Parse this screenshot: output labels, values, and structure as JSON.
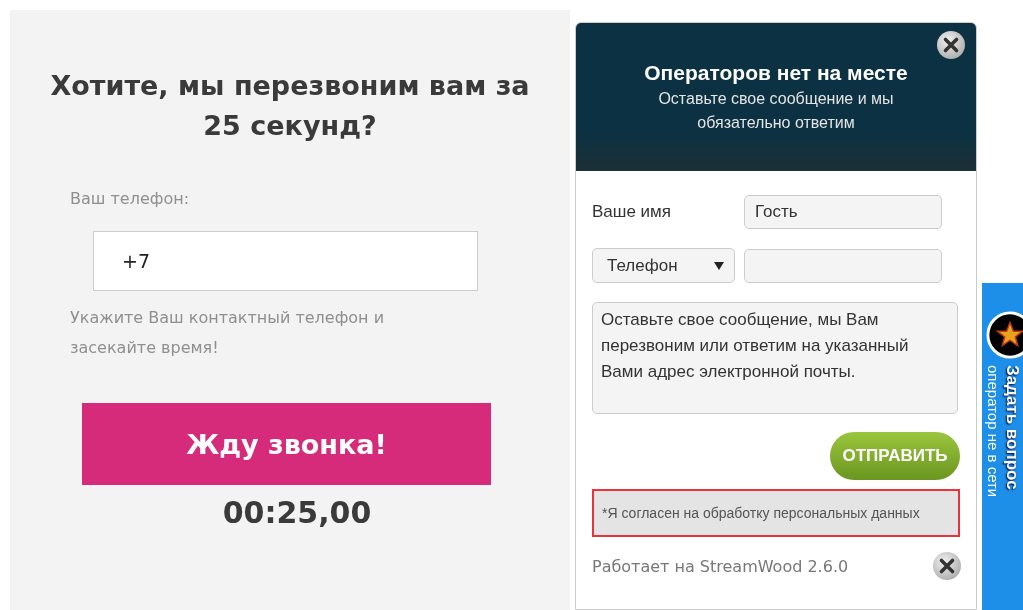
{
  "callback_form": {
    "title": "Хотите, мы перезвоним вам за 25 секунд?",
    "phone_label": "Ваш телефон:",
    "phone_value": "+7",
    "hint": "Укажите Ваш контактный телефон и засекайте время!",
    "button": "Жду звонка!",
    "timer": "00:25,00"
  },
  "chat_widget": {
    "title": "Операторов нет на месте",
    "subtitle": "Оставьте свое сообщение и мы обязательно ответим",
    "name_label": "Ваше имя",
    "name_value": "Гость",
    "contact_select": "Телефон",
    "message": "Оставьте свое сообщение, мы Вам перезвоним или ответим на указанный Вами адрес электронной почты.",
    "send_button": "ОТПРАВИТЬ",
    "consent": "*Я согласен на обработку персональных данных",
    "footer": "Работает на StreamWood 2.6.0"
  },
  "side_tab": {
    "title": "Задать вопрос",
    "status": "оператор не в сети"
  }
}
